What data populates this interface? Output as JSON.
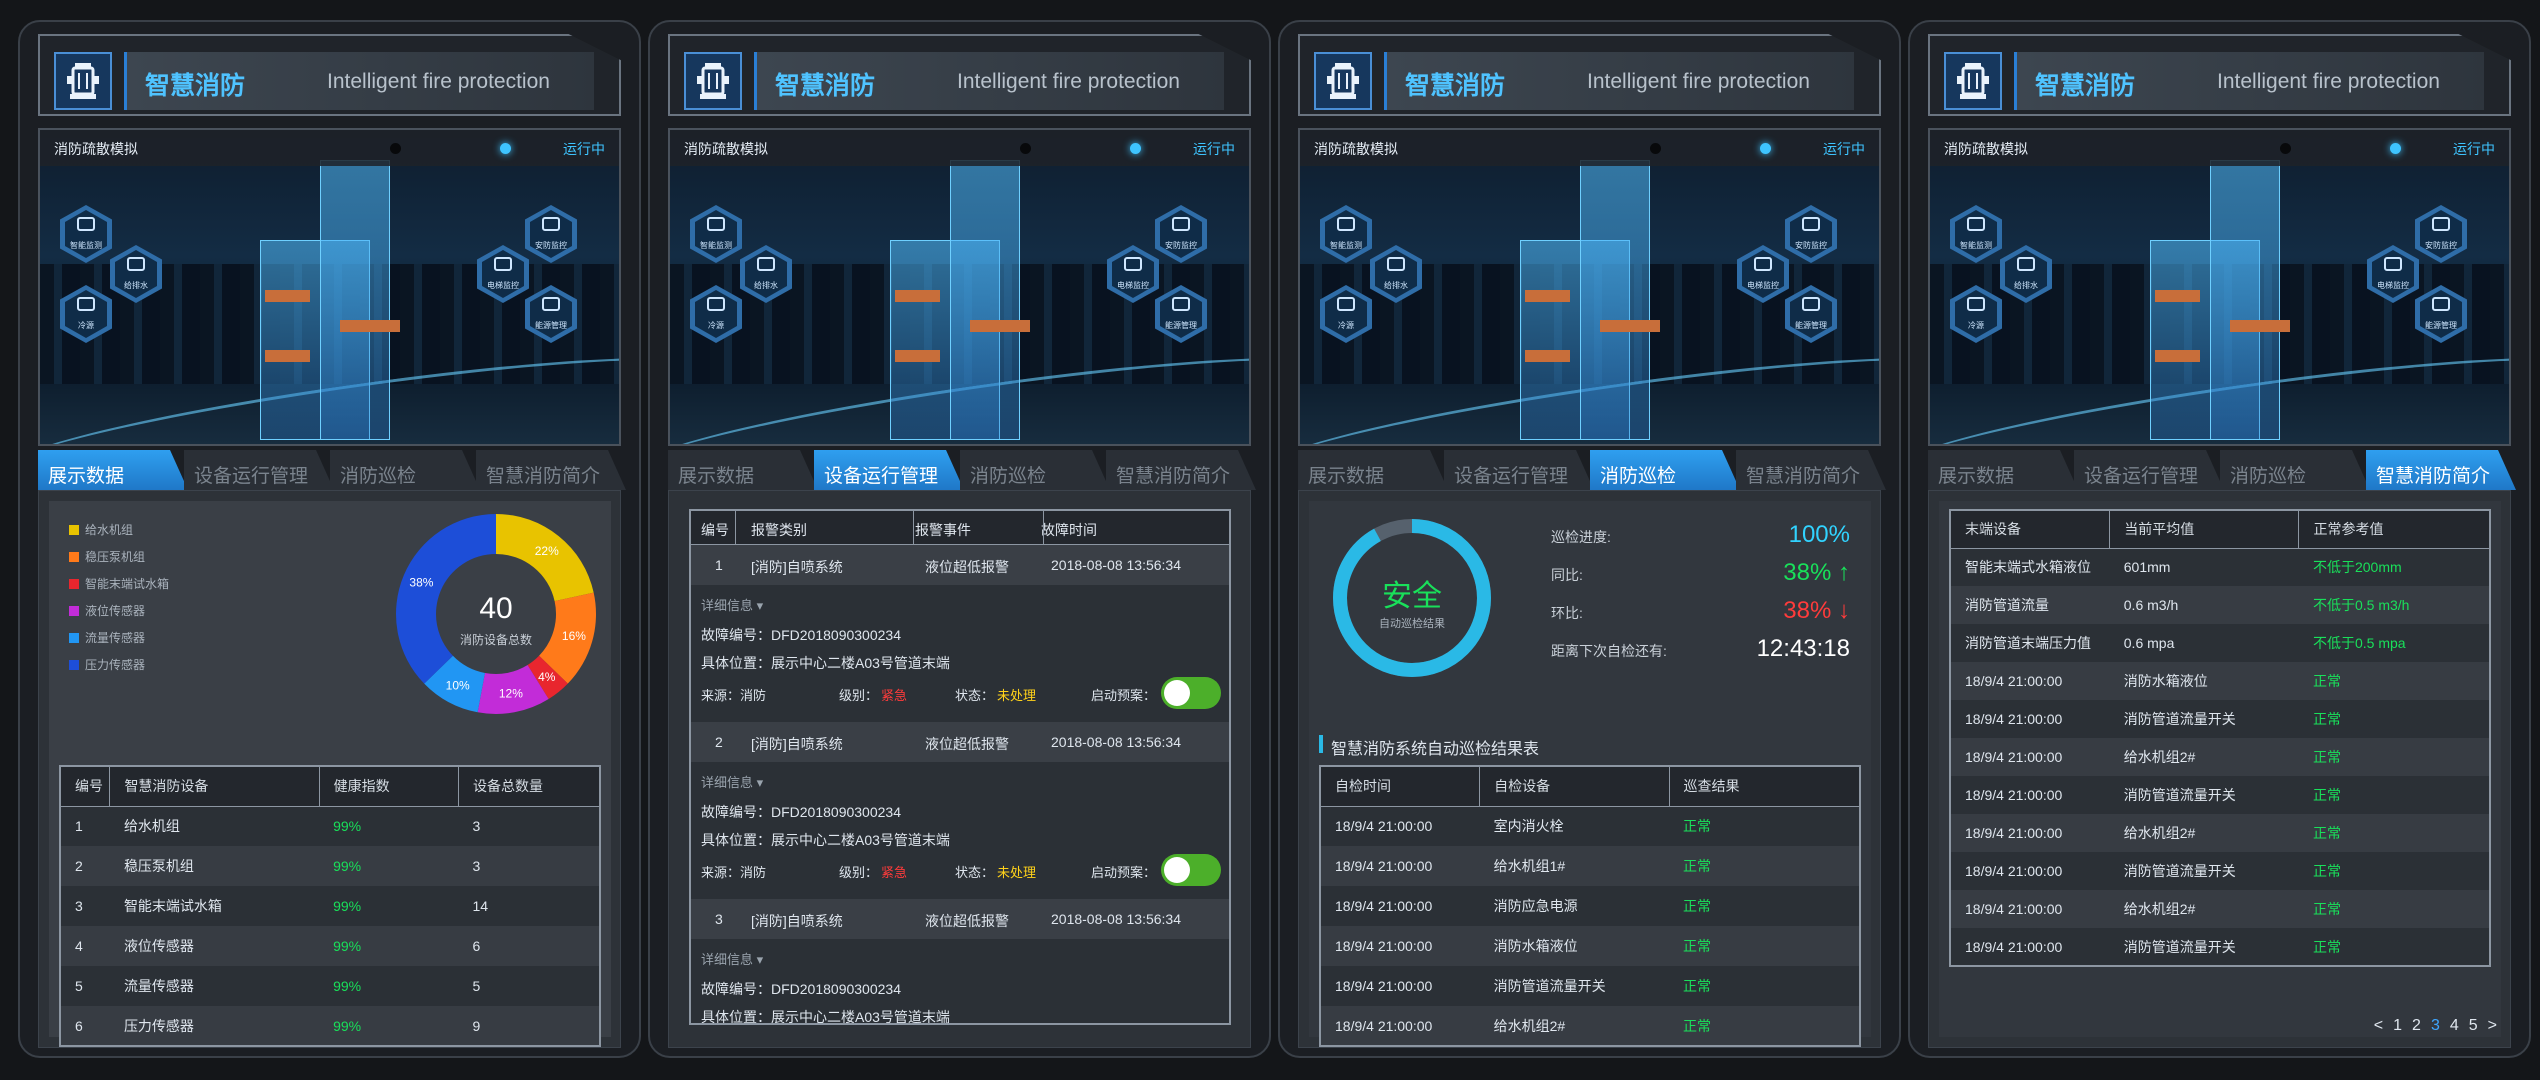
{
  "brand": {
    "title_cn": "智慧消防",
    "title_en": "Intelligent fire protection"
  },
  "scene": {
    "label": "消防疏散模拟",
    "status": "运行中",
    "left_hexes": [
      "智能监测",
      "给排水",
      "冷源"
    ],
    "right_hexes": [
      "安防监控",
      "电梯监控",
      "能源管理"
    ]
  },
  "tabs": [
    "展示数据",
    "设备运行管理",
    "消防巡检",
    "智慧消防简介"
  ],
  "panel1": {
    "legend": [
      {
        "label": "给水机组",
        "color": "#e8c300"
      },
      {
        "label": "稳压泵机组",
        "color": "#ff7a1a"
      },
      {
        "label": "智能末端试水箱",
        "color": "#e8262e"
      },
      {
        "label": "液位传感器",
        "color": "#c22cd8"
      },
      {
        "label": "流量传感器",
        "color": "#2196f3"
      },
      {
        "label": "压力传感器",
        "color": "#1d4ed8"
      }
    ],
    "donut_total": "40",
    "donut_caption": "消防设备总数",
    "table_headers": [
      "编号",
      "智慧消防设备",
      "健康指数",
      "设备总数量"
    ],
    "rows": [
      [
        "1",
        "给水机组",
        "99%",
        "3"
      ],
      [
        "2",
        "稳压泵机组",
        "99%",
        "3"
      ],
      [
        "3",
        "智能末端试水箱",
        "99%",
        "14"
      ],
      [
        "4",
        "液位传感器",
        "99%",
        "6"
      ],
      [
        "5",
        "流量传感器",
        "99%",
        "5"
      ],
      [
        "6",
        "压力传感器",
        "99%",
        "9"
      ]
    ]
  },
  "chart_data": {
    "type": "pie",
    "categories": [
      "给水机组",
      "稳压泵机组",
      "智能末端试水箱",
      "液位传感器",
      "流量传感器",
      "压力传感器"
    ],
    "values": [
      22,
      16,
      4,
      12,
      10,
      38
    ],
    "labels": [
      "22%",
      "16%",
      "4%",
      "12%",
      "10%",
      "38%"
    ],
    "colors": [
      "#e8c300",
      "#ff7a1a",
      "#e8262e",
      "#c22cd8",
      "#2196f3",
      "#1d4ed8"
    ]
  },
  "panel2": {
    "headers": [
      "编号",
      "报警类别",
      "报警事件",
      "故障时间"
    ],
    "detail_label": "详细信息 ▾",
    "alarms": [
      {
        "no": "1",
        "type": "[消防]自喷系统",
        "event": "液位超低报警",
        "time": "2018-08-08 13:56:34",
        "fault_no": "故障编号：DFD2018090300234",
        "location": "具体位置：展示中心二楼A03号管道末端",
        "source": "来源：消防",
        "level_label": "级别：",
        "level": "紧急",
        "state_label": "状态：",
        "state": "未处理",
        "plan": "启动预案："
      },
      {
        "no": "2",
        "type": "[消防]自喷系统",
        "event": "液位超低报警",
        "time": "2018-08-08 13:56:34",
        "fault_no": "故障编号：DFD2018090300234",
        "location": "具体位置：展示中心二楼A03号管道末端",
        "source": "来源：消防",
        "level_label": "级别：",
        "level": "紧急",
        "state_label": "状态：",
        "state": "未处理",
        "plan": "启动预案："
      },
      {
        "no": "3",
        "type": "[消防]自喷系统",
        "event": "液位超低报警",
        "time": "2018-08-08 13:56:34",
        "fault_no": "故障编号：DFD2018090300234",
        "location": "具体位置：展示中心二楼A03号管道末端"
      }
    ]
  },
  "panel3": {
    "gauge_main": "安全",
    "gauge_caption": "自动巡检结果",
    "gauge_progress": 0.92,
    "progress_label": "巡检进度:",
    "progress_value": "100%",
    "yoy_label": "同比:",
    "yoy_value": "38% ↑",
    "mom_label": "环比:",
    "mom_value": "38% ↓",
    "next_label": "距离下次自检还有:",
    "next_value": "12:43:18",
    "section_title": "智慧消防系统自动巡检结果表",
    "headers": [
      "自检时间",
      "自检设备",
      "巡查结果"
    ],
    "rows": [
      [
        "18/9/4  21:00:00",
        "室内消火栓",
        "正常"
      ],
      [
        "18/9/4  21:00:00",
        "给水机组1#",
        "正常"
      ],
      [
        "18/9/4  21:00:00",
        "消防应急电源",
        "正常"
      ],
      [
        "18/9/4  21:00:00",
        "消防水箱液位",
        "正常"
      ],
      [
        "18/9/4  21:00:00",
        "消防管道流量开关",
        "正常"
      ],
      [
        "18/9/4  21:00:00",
        "给水机组2#",
        "正常"
      ]
    ]
  },
  "panel4": {
    "headers": [
      "末端设备",
      "当前平均值",
      "正常参考值"
    ],
    "rows": [
      [
        "智能末端式水箱液位",
        "601mm",
        "不低于200mm"
      ],
      [
        "消防管道流量",
        "0.6 m3/h",
        "不低于0.5 m3/h"
      ],
      [
        "消防管道末端压力值",
        "0.6 mpa",
        "不低于0.5 mpa"
      ],
      [
        "18/9/4  21:00:00",
        "消防水箱液位",
        "正常"
      ],
      [
        "18/9/4  21:00:00",
        "消防管道流量开关",
        "正常"
      ],
      [
        "18/9/4  21:00:00",
        "给水机组2#",
        "正常"
      ],
      [
        "18/9/4  21:00:00",
        "消防管道流量开关",
        "正常"
      ],
      [
        "18/9/4  21:00:00",
        "给水机组2#",
        "正常"
      ],
      [
        "18/9/4  21:00:00",
        "消防管道流量开关",
        "正常"
      ],
      [
        "18/9/4  21:00:00",
        "给水机组2#",
        "正常"
      ],
      [
        "18/9/4  21:00:00",
        "消防管道流量开关",
        "正常"
      ]
    ],
    "pager": [
      "<",
      "1",
      "2",
      "3",
      "4",
      "5",
      ">"
    ],
    "pager_active": "3",
    "colors": {
      "green": "#19e05a",
      "active_page": "#3ea6ff"
    }
  }
}
